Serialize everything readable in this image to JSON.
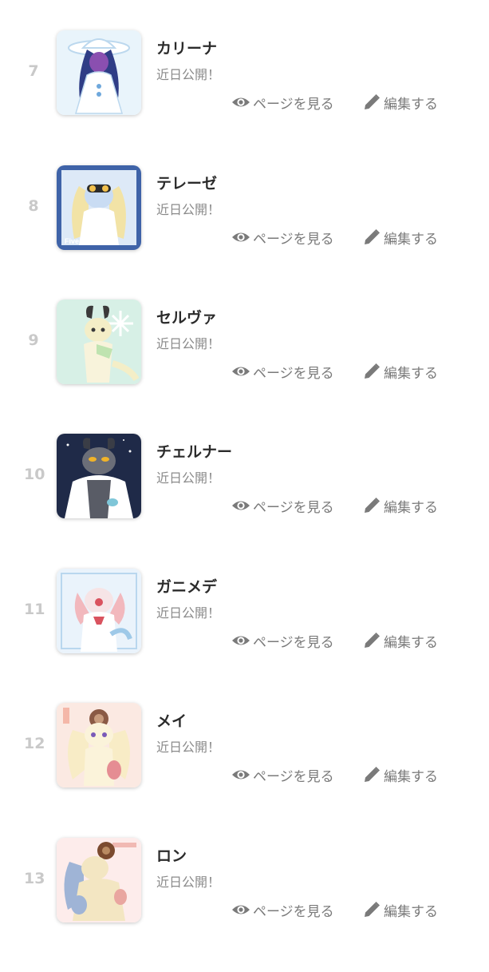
{
  "actions": {
    "view_label": "ページを見る",
    "edit_label": "編集する"
  },
  "colors": {
    "rank": "#c9c9c9",
    "name": "#2b2b2b",
    "muted": "#7a7a7a"
  },
  "icons": {
    "view": "eye-icon",
    "edit": "pencil-icon"
  },
  "characters": [
    {
      "rank": "7",
      "name": "カリーナ",
      "status": "近日公開！",
      "thumb": {
        "bg": "#e9f4fb",
        "accent": "#2f3d86",
        "fur": "#ffffff",
        "caption": ""
      }
    },
    {
      "rank": "8",
      "name": "テレーゼ",
      "status": "近日公開！",
      "thumb": {
        "bg": "#3f63a8",
        "accent": "#f2e3a6",
        "fur": "#c9dcf3",
        "caption": "Five seconds"
      }
    },
    {
      "rank": "9",
      "name": "セルヴァ",
      "status": "近日公開！",
      "thumb": {
        "bg": "#d7f0e6",
        "accent": "#3a3a3a",
        "fur": "#f4eec7",
        "caption": ""
      }
    },
    {
      "rank": "10",
      "name": "チェルナー",
      "status": "近日公開！",
      "thumb": {
        "bg": "#1f2a48",
        "accent": "#f0b32a",
        "fur": "#6b6e78",
        "caption": ""
      }
    },
    {
      "rank": "11",
      "name": "ガニメデ",
      "status": "近日公開！",
      "thumb": {
        "bg": "#eaf3fb",
        "accent": "#d9535f",
        "fur": "#f6e4e6",
        "caption": ""
      }
    },
    {
      "rank": "12",
      "name": "メイ",
      "status": "近日公開！",
      "thumb": {
        "bg": "#fbe9e2",
        "accent": "#8a5a45",
        "fur": "#f8ecc6",
        "caption": ""
      }
    },
    {
      "rank": "13",
      "name": "ロン",
      "status": "近日公開！",
      "thumb": {
        "bg": "#fdeceb",
        "accent": "#7b4a2f",
        "fur": "#f3e6c2",
        "caption": ""
      }
    }
  ]
}
